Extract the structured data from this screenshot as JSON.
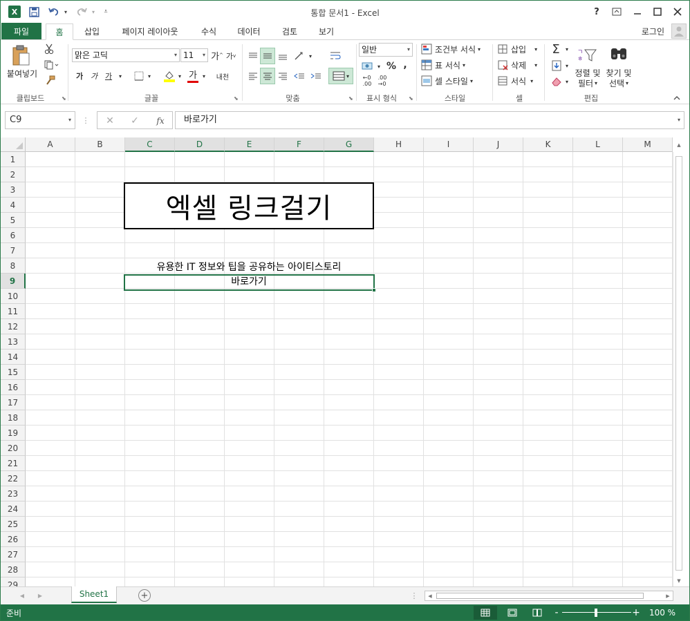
{
  "app": {
    "title": "통합 문서1 - Excel",
    "icon": "excel-icon",
    "logo_letter": "X"
  },
  "qat": {
    "save": "save-icon",
    "undo": "undo-icon",
    "redo": "redo-icon",
    "customize": "customize-qat-icon"
  },
  "window": {
    "help": "?",
    "ribbon_display": "ribbon-display-icon",
    "minimize": "minimize-icon",
    "maximize": "maximize-icon",
    "close": "close-icon"
  },
  "tabs": [
    {
      "label": "파일"
    },
    {
      "label": "홈"
    },
    {
      "label": "삽입"
    },
    {
      "label": "페이지 레이아웃"
    },
    {
      "label": "수식"
    },
    {
      "label": "데이터"
    },
    {
      "label": "검토"
    },
    {
      "label": "보기"
    }
  ],
  "account": {
    "login": "로그인"
  },
  "ribbon": {
    "clipboard": {
      "label": "클립보드",
      "paste": "붙여넣기"
    },
    "font": {
      "label": "글꼴",
      "name": "맑은 고딕",
      "size": "11",
      "bold": "가",
      "italic": "가",
      "underline": "가",
      "grow": "가",
      "shrink": "가",
      "color": "가",
      "phonetic": "내천"
    },
    "alignment": {
      "label": "맞춤"
    },
    "number": {
      "label": "표시 형식",
      "format": "일반",
      "percent": "%",
      "comma": ","
    },
    "styles": {
      "label": "스타일",
      "conditional": "조건부 서식",
      "table": "표 서식",
      "cell": "셀 스타일"
    },
    "cells": {
      "label": "셀",
      "insert": "삽입",
      "delete": "삭제",
      "format": "서식"
    },
    "editing": {
      "label": "편집",
      "sum": "Σ",
      "sort1": "정렬 및",
      "sort2": "필터",
      "find1": "찾기 및",
      "find2": "선택"
    }
  },
  "formula_bar": {
    "name_box": "C9",
    "cancel": "✕",
    "enter": "✓",
    "fx": "fx",
    "content": "바로가기"
  },
  "columns": [
    "A",
    "B",
    "C",
    "D",
    "E",
    "F",
    "G",
    "H",
    "I",
    "J",
    "K",
    "L",
    "M"
  ],
  "rows": [
    "1",
    "2",
    "3",
    "4",
    "5",
    "6",
    "7",
    "8",
    "9",
    "10",
    "11",
    "12",
    "13",
    "14",
    "15",
    "16",
    "17",
    "18",
    "19",
    "20",
    "21",
    "22",
    "23",
    "24",
    "25",
    "26",
    "27",
    "28",
    "29"
  ],
  "cells": {
    "title": "엑셀 링크걸기",
    "c8": "유용한 IT 정보와 팁을 공유하는 아이티스토리",
    "c9": "바로가기"
  },
  "sheets": [
    {
      "name": "Sheet1"
    }
  ],
  "add_sheet": "+",
  "status": {
    "ready": "준비",
    "zoom": "100 %",
    "zoom_minus": "-",
    "zoom_plus": "+"
  },
  "colors": {
    "accent": "#217346",
    "selection_fill": "#cde8d6"
  }
}
